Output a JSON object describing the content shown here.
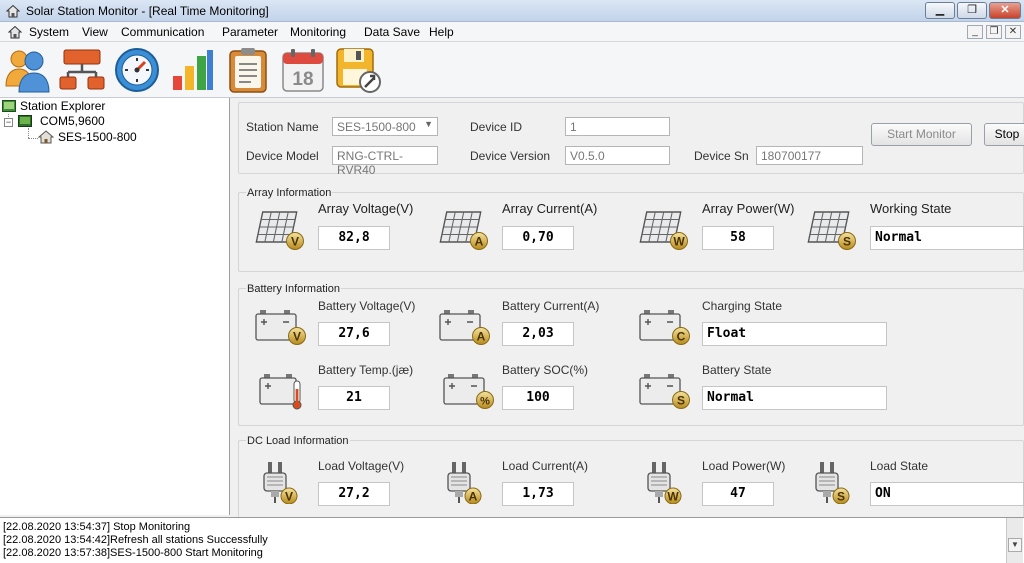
{
  "window": {
    "title": "Solar Station Monitor - [Real Time Monitoring]",
    "minimize": "▁",
    "restore": "❐",
    "close": "✕"
  },
  "menu": [
    {
      "label": "System"
    },
    {
      "label": "View"
    },
    {
      "label": "Communication"
    },
    {
      "label": "Parameter"
    },
    {
      "label": "Monitoring"
    },
    {
      "label": "Data Save"
    },
    {
      "label": "Help"
    }
  ],
  "mdi": {
    "minimize": "_",
    "restore": "❐",
    "close": "✕"
  },
  "toolbar": {
    "icons": [
      "users-icon",
      "network-icon",
      "gauge-icon",
      "bar-chart-icon",
      "clipboard-icon",
      "calendar-icon",
      "save-settings-icon"
    ],
    "calendar_day": "18"
  },
  "tree": {
    "root": "Station Explorer",
    "port": "COM5,9600",
    "device": "SES-1500-800",
    "expander": "−"
  },
  "station": {
    "name_label": "Station Name",
    "name_value": "SES-1500-800",
    "device_id_label": "Device ID",
    "device_id_value": "1",
    "model_label": "Device Model",
    "model_value": "RNG-CTRL-RVR40",
    "version_label": "Device Version",
    "version_value": "V0.5.0",
    "sn_label": "Device Sn",
    "sn_value": "180700177",
    "start_label": "Start Monitor",
    "stop_label": "Stop"
  },
  "array": {
    "title": "Array Information",
    "voltage_label": "Array Voltage(V)",
    "voltage": "82,8",
    "current_label": "Array Current(A)",
    "current": "0,70",
    "power_label": "Array Power(W)",
    "power": "58",
    "state_label": "Working State",
    "state": "Normal"
  },
  "battery": {
    "title": "Battery Information",
    "voltage_label": "Battery Voltage(V)",
    "voltage": "27,6",
    "current_label": "Battery Current(A)",
    "current": "2,03",
    "charging_label": "Charging State",
    "charging": "Float",
    "temp_label": "Battery Temp.(jæ)",
    "temp": "21",
    "soc_label": "Battery SOC(%)",
    "soc": "100",
    "state_label": "Battery State",
    "state": "Normal"
  },
  "load": {
    "title": "DC Load Information",
    "voltage_label": "Load Voltage(V)",
    "voltage": "27,2",
    "current_label": "Load Current(A)",
    "current": "1,73",
    "power_label": "Load Power(W)",
    "power": "47",
    "state_label": "Load State",
    "state": "ON"
  },
  "badges": {
    "v": "V",
    "a": "A",
    "w": "W",
    "s": "S",
    "c": "C",
    "pct": "%"
  },
  "log": [
    "[22.08.2020 13:54:37] Stop Monitoring",
    "[22.08.2020 13:54:42]Refresh all stations Successfully",
    "[22.08.2020 13:57:38]SES-1500-800 Start Monitoring"
  ],
  "colors": {
    "badge": "#c9a227",
    "accent": "#3a78c2"
  }
}
